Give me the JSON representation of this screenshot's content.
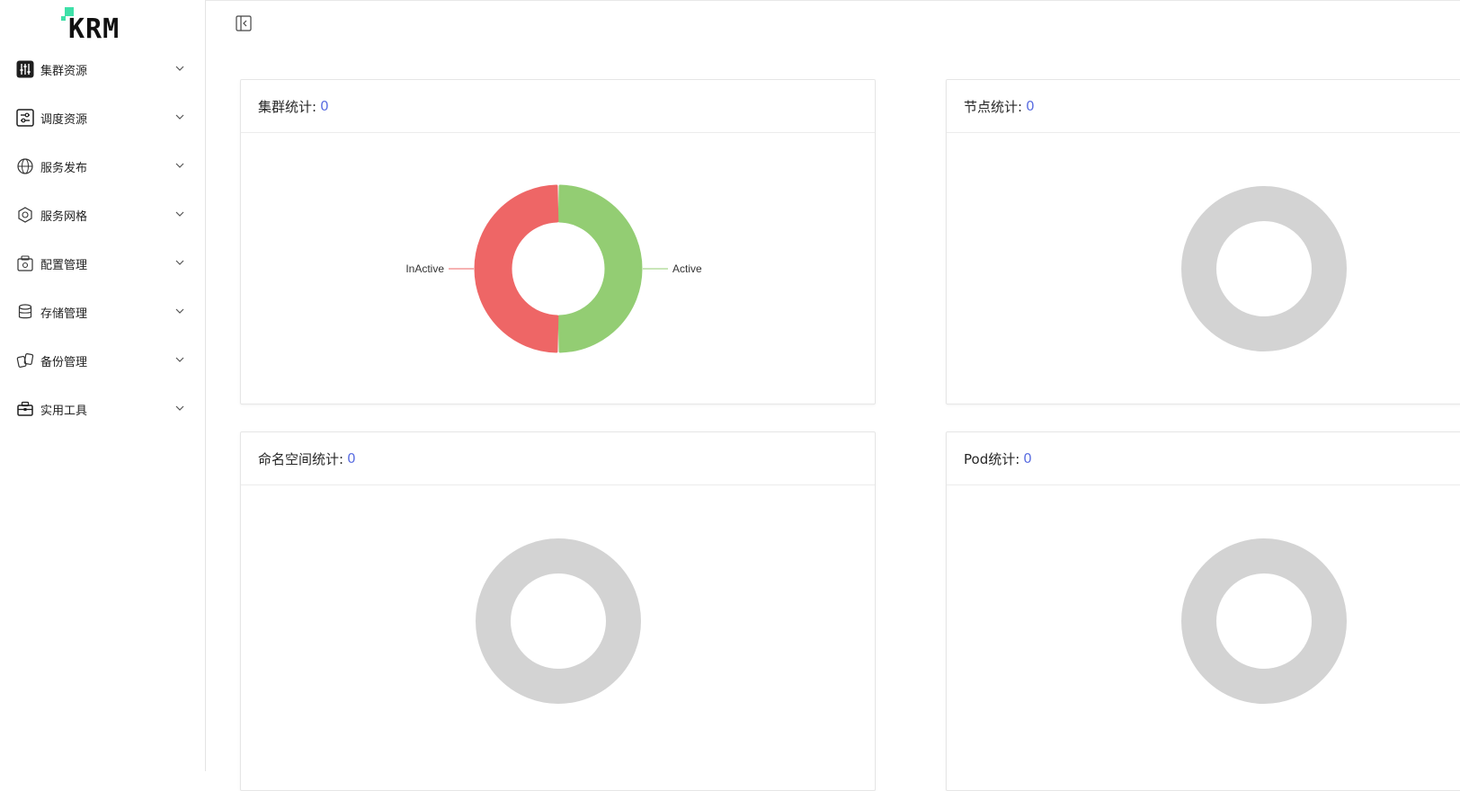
{
  "logo": {
    "text": "KRM"
  },
  "sidebar": {
    "items": [
      {
        "label": "集群资源",
        "icon": "sliders-icon"
      },
      {
        "label": "调度资源",
        "icon": "schedule-icon"
      },
      {
        "label": "服务发布",
        "icon": "globe-icon"
      },
      {
        "label": "服务网格",
        "icon": "mesh-icon"
      },
      {
        "label": "配置管理",
        "icon": "config-icon"
      },
      {
        "label": "存储管理",
        "icon": "database-icon"
      },
      {
        "label": "备份管理",
        "icon": "backup-icon"
      },
      {
        "label": "实用工具",
        "icon": "toolbox-icon"
      }
    ]
  },
  "cards": [
    {
      "title": "集群统计:",
      "count": "0"
    },
    {
      "title": "节点统计:",
      "count": "0"
    },
    {
      "title": "命名空间统计:",
      "count": "0"
    },
    {
      "title": "Pod统计:",
      "count": "0"
    }
  ],
  "chart_data": [
    {
      "type": "pie",
      "title": "",
      "series": [
        {
          "name": "Active",
          "value": 1,
          "color": "#93cd73"
        },
        {
          "name": "InActive",
          "value": 1,
          "color": "#ee6666"
        }
      ]
    },
    {
      "type": "pie",
      "title": "",
      "series": [],
      "empty_color": "#d3d3d3"
    },
    {
      "type": "pie",
      "title": "",
      "series": [],
      "empty_color": "#d3d3d3"
    },
    {
      "type": "pie",
      "title": "",
      "series": [],
      "empty_color": "#d3d3d3"
    }
  ],
  "colors": {
    "accent": "#5b6ee1",
    "logo": "#3ee0a8"
  }
}
